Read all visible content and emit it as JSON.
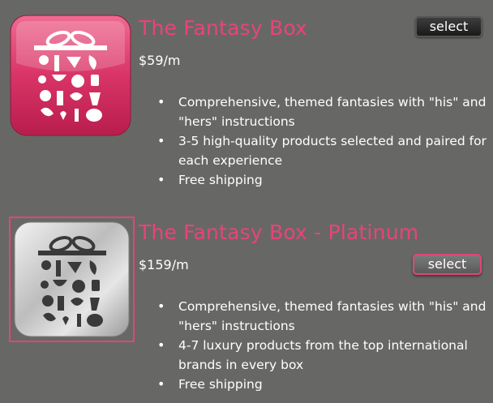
{
  "products": [
    {
      "title": "The Fantasy Box",
      "price": "$59/m",
      "select_label": "select",
      "icon": "gift-box-icon",
      "icon_style": "pink",
      "features": [
        "Comprehensive, themed fantasies with \"his\" and \"hers\" instructions",
        "3-5 high-quality products selected and paired for each experience",
        "Free shipping"
      ]
    },
    {
      "title": "The Fantasy Box - Platinum",
      "price": "$159/m",
      "select_label": "select",
      "icon": "gift-box-icon",
      "icon_style": "silver",
      "selected": true,
      "features": [
        "Comprehensive, themed fantasies with \"his\" and \"hers\" instructions",
        "4-7 luxury products from the top international brands in every box",
        "Free shipping"
      ]
    }
  ],
  "colors": {
    "background": "#676866",
    "accent": "#e9437a",
    "text": "#ffffff"
  }
}
